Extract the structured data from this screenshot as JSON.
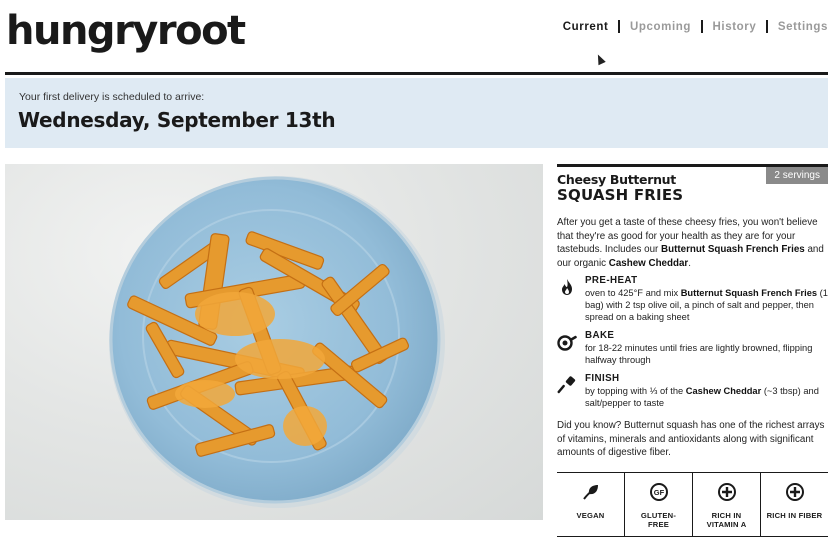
{
  "brand": {
    "logo_text": "hungryroot"
  },
  "nav": {
    "items": [
      {
        "label": "Current",
        "active": true
      },
      {
        "label": "Upcoming",
        "active": false
      },
      {
        "label": "History",
        "active": false
      },
      {
        "label": "Settings",
        "active": false
      }
    ]
  },
  "delivery": {
    "subtitle": "Your first delivery is scheduled to arrive:",
    "date": "Wednesday, September 13th"
  },
  "recipe": {
    "title_line1": "Cheesy Butternut",
    "title_line2": "SQUASH FRIES",
    "servings": "2 servings",
    "description": {
      "p1": "After you get a taste of these cheesy fries, you won't believe that they're as good for your health as they are for your tastebuds. Includes our ",
      "b1": "Butternut Squash French Fries",
      "p2": " and our organic ",
      "b2": "Cashew Cheddar",
      "p3": "."
    },
    "steps": [
      {
        "icon": "flame-icon",
        "title": "PRE-HEAT",
        "t1": "oven to 425°F and mix ",
        "b1": "Butternut Squash French Fries",
        "t2": " (1 bag) with 2 tsp olive oil, a pinch of salt and pepper, then spread on a baking sheet"
      },
      {
        "icon": "pan-icon",
        "title": "BAKE",
        "t1": "for 18-22 minutes until fries are lightly browned, flipping halfway through"
      },
      {
        "icon": "spatula-icon",
        "title": "FINISH",
        "t1": "by topping with ⅓ of the ",
        "b1": "Cashew Cheddar",
        "t2": " (~3 tbsp) and salt/pepper to taste"
      }
    ],
    "fact": {
      "t1": "Did you know? Butternut squash has one of the richest arrays of vitamins, minerals and antioxidants along with significant amounts of digestive fiber."
    },
    "badges": [
      {
        "icon": "leaf-icon",
        "label_line1": "VEGAN",
        "label_line2": ""
      },
      {
        "icon": "gluten-free-icon",
        "label_line1": "GLUTEN-",
        "label_line2": "FREE"
      },
      {
        "icon": "vitamin-icon",
        "label_line1": "RICH IN",
        "label_line2": "VITAMIN A"
      },
      {
        "icon": "fiber-icon",
        "label_line1": "RICH IN FIBER",
        "label_line2": ""
      }
    ]
  },
  "colors": {
    "banner_bg": "#dfeaf3",
    "text_dark": "#1a1a1a",
    "nav_inactive": "#9a9a9a",
    "servings_badge": "#8a8a8a",
    "plate_blue": "#9ec3dc",
    "fries_orange": "#e8962a"
  }
}
